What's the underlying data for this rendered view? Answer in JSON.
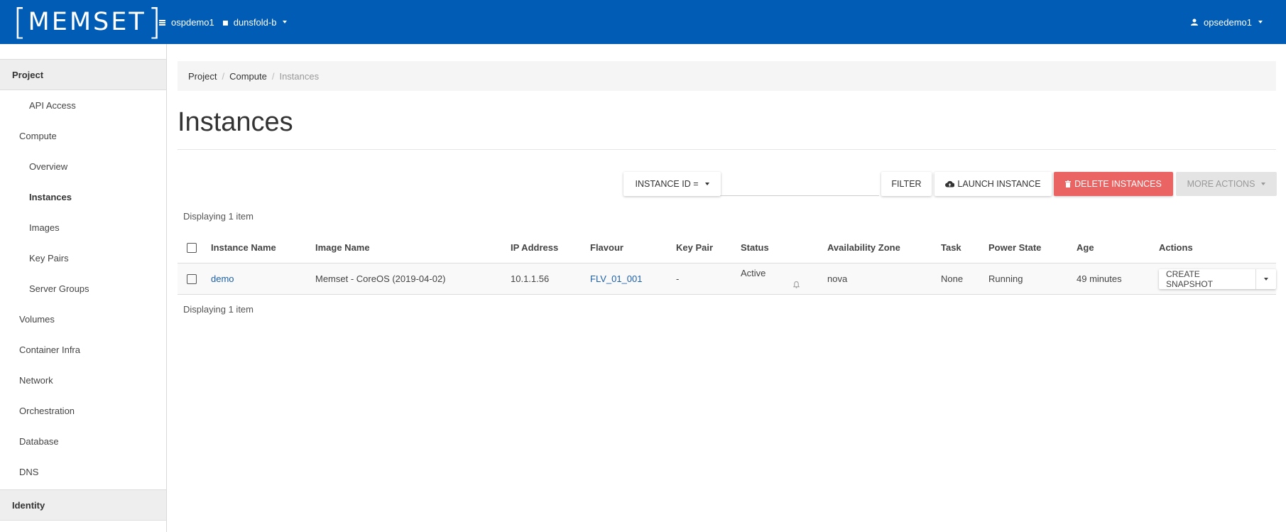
{
  "topbar": {
    "logo_left": "[",
    "logo_text": "MEMSET",
    "logo_right": "]",
    "project": "ospdemo1",
    "region": "dunsfold-b",
    "user": "opsedemo1"
  },
  "sidebar": {
    "sections": [
      "Project",
      "Identity"
    ],
    "items": [
      {
        "label": "API Access"
      },
      {
        "label": "Compute"
      },
      {
        "label": "Overview"
      },
      {
        "label": "Instances"
      },
      {
        "label": "Images"
      },
      {
        "label": "Key Pairs"
      },
      {
        "label": "Server Groups"
      },
      {
        "label": "Volumes"
      },
      {
        "label": "Container Infra"
      },
      {
        "label": "Network"
      },
      {
        "label": "Orchestration"
      },
      {
        "label": "Database"
      },
      {
        "label": "DNS"
      }
    ]
  },
  "breadcrumb": [
    "Project",
    "/",
    "Compute",
    "/",
    "Instances"
  ],
  "page": {
    "title": "Instances"
  },
  "toolbar": {
    "filter_field": "INSTANCE ID =",
    "filter_button": "FILTER",
    "launch_button": "LAUNCH INSTANCE",
    "delete_button": "DELETE INSTANCES",
    "more_button": "MORE ACTIONS",
    "danger_color": "#ea6464"
  },
  "table": {
    "count_text": "Displaying 1 item",
    "columns": [
      "Instance Name",
      "Image Name",
      "IP Address",
      "Flavour",
      "Key Pair",
      "Status",
      "Availability Zone",
      "Task",
      "Power State",
      "Age",
      "Actions"
    ],
    "rows": [
      {
        "instance_name": "demo",
        "image_name": "Memset - CoreOS (2019-04-02)",
        "ip_address": "10.1.1.56",
        "flavour": "FLV_01_001",
        "key_pair": "-",
        "status": "Active",
        "availability_zone": "nova",
        "task": "None",
        "power_state": "Running",
        "age": "49 minutes",
        "action": "CREATE SNAPSHOT"
      }
    ]
  }
}
